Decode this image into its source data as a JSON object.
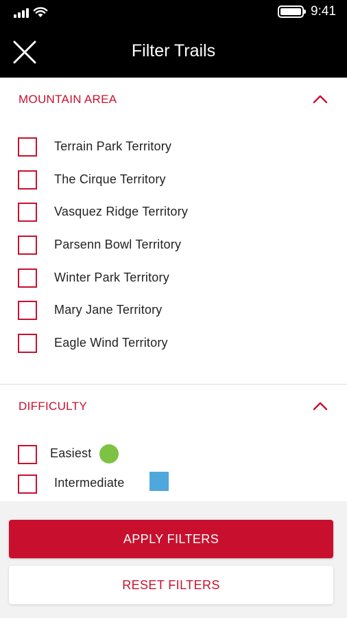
{
  "status_bar": {
    "time": "9:41",
    "icons": [
      "cellular-signal-icon",
      "wifi-icon",
      "battery-icon"
    ]
  },
  "nav": {
    "title": "Filter Trails",
    "close_icon": "close-icon"
  },
  "sections": {
    "mountain_area": {
      "title": "MOUNTAIN AREA",
      "expanded": true,
      "options": [
        {
          "label": "Terrain Park Territory",
          "checked": false
        },
        {
          "label": "The Cirque Territory",
          "checked": false
        },
        {
          "label": "Vasquez Ridge Territory",
          "checked": false
        },
        {
          "label": "Parsenn Bowl Territory",
          "checked": false
        },
        {
          "label": "Winter Park Territory",
          "checked": false
        },
        {
          "label": "Mary Jane Territory",
          "checked": false
        },
        {
          "label": "Eagle Wind Territory",
          "checked": false
        }
      ]
    },
    "difficulty": {
      "title": "DIFFICULTY",
      "expanded": true,
      "options": [
        {
          "label": "Easiest",
          "checked": false,
          "icon": "green-circle-icon",
          "color": "#7dc242"
        },
        {
          "label": "Intermediate",
          "checked": false,
          "icon": "blue-square-icon",
          "color": "#4fa8dc"
        }
      ]
    }
  },
  "footer": {
    "apply_label": "APPLY FILTERS",
    "reset_label": "RESET FILTERS"
  },
  "colors": {
    "accent": "#c8102e",
    "header_bg": "#000000",
    "footer_bg": "#f2f2f2"
  }
}
